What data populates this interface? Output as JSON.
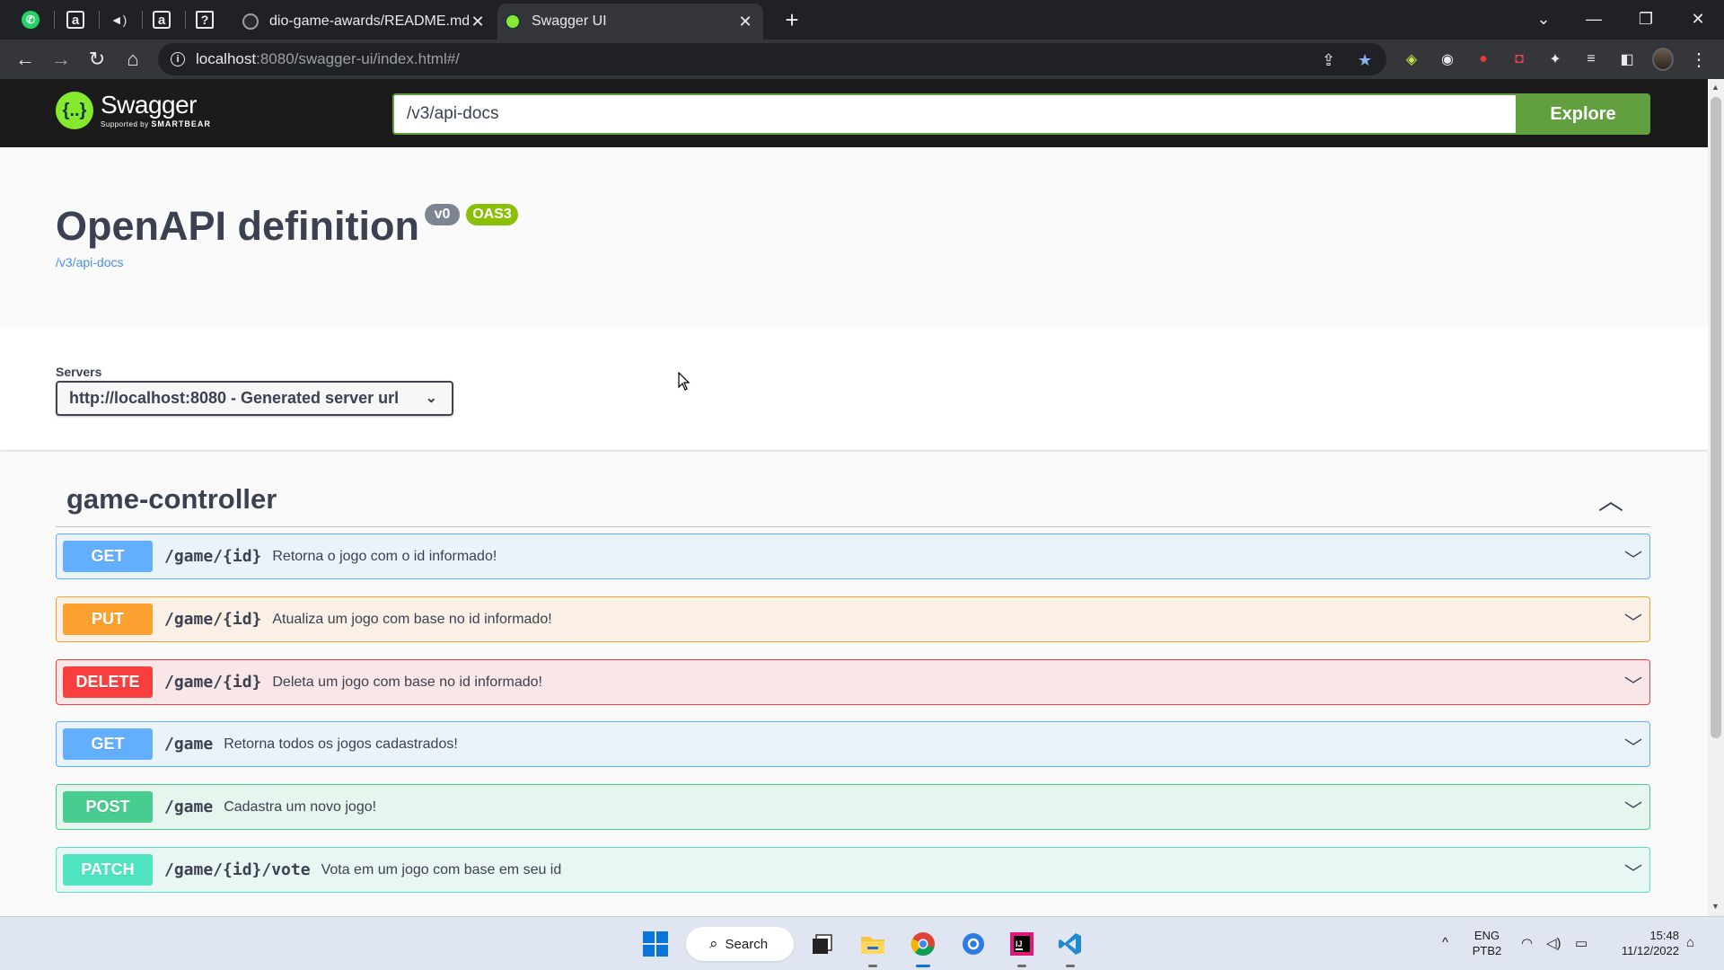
{
  "browser": {
    "pinned_tabs": [
      {
        "name": "whatsapp",
        "glyph": "✆"
      },
      {
        "name": "a",
        "glyph": "a"
      },
      {
        "name": "audio",
        "glyph": "◄)"
      },
      {
        "name": "a2",
        "glyph": "a"
      },
      {
        "name": "help",
        "glyph": "?"
      }
    ],
    "tabs": [
      {
        "title": "dio-game-awards/README.md at",
        "active": false,
        "close": "✕"
      },
      {
        "title": "Swagger UI",
        "active": true,
        "close": "✕"
      }
    ],
    "new_tab": "+",
    "window_controls": {
      "dropdown": "⌄",
      "minimize": "—",
      "restore": "❐",
      "close": "✕"
    },
    "nav": {
      "back": "←",
      "forward": "→",
      "reload": "↻",
      "home": "⌂"
    },
    "address": {
      "host": "localhost",
      "path": ":8080/swagger-ui/index.html#/"
    },
    "omnibox_icons": {
      "share": "⇪",
      "bookmark": "★"
    },
    "extension_icons": [
      "◈",
      "◉",
      "●",
      "◘",
      "✦",
      "≡",
      "◧"
    ]
  },
  "swagger": {
    "logo": {
      "glyph": "{..}",
      "name": "Swagger",
      "supported_by": "Supported by",
      "brand": "SMARTBEAR"
    },
    "url_input": "/v3/api-docs",
    "explore_label": "Explore",
    "title": "OpenAPI definition",
    "version_badge": "v0",
    "oas_badge": "OAS3",
    "spec_link": "/v3/api-docs",
    "servers_label": "Servers",
    "server_selected": "http://localhost:8080 - Generated server url",
    "tag": {
      "name": "game-controller",
      "collapse_icon": "︿"
    },
    "operations": [
      {
        "method": "GET",
        "path": "/game/{id}",
        "summary": "Retorna o jogo com o id informado!"
      },
      {
        "method": "PUT",
        "path": "/game/{id}",
        "summary": "Atualiza um jogo com base no id informado!"
      },
      {
        "method": "DELETE",
        "path": "/game/{id}",
        "summary": "Deleta um jogo com base no id informado!"
      },
      {
        "method": "GET",
        "path": "/game",
        "summary": "Retorna todos os jogos cadastrados!"
      },
      {
        "method": "POST",
        "path": "/game",
        "summary": "Cadastra um novo jogo!"
      },
      {
        "method": "PATCH",
        "path": "/game/{id}/vote",
        "summary": "Vota em um jogo com base em seu id"
      }
    ],
    "expand_icon": "﹀"
  },
  "taskbar": {
    "search_label": "Search",
    "apps": [
      "task-view",
      "file-explorer",
      "chrome",
      "settings-app",
      "intellij",
      "vscode"
    ],
    "tray": {
      "overflow": "^",
      "lang_top": "ENG",
      "lang_bottom": "PTB2",
      "wifi": "◠",
      "volume": "◁)",
      "battery": "▭",
      "time": "15:48",
      "date": "11/12/2022",
      "notif": "⌂"
    }
  },
  "colors": {
    "get": "#61affe",
    "put": "#fca130",
    "delete": "#f93e3e",
    "post": "#49cc90",
    "patch": "#50e3c2",
    "swagger_green": "#62a03f",
    "topbar": "#1b1b1b"
  }
}
